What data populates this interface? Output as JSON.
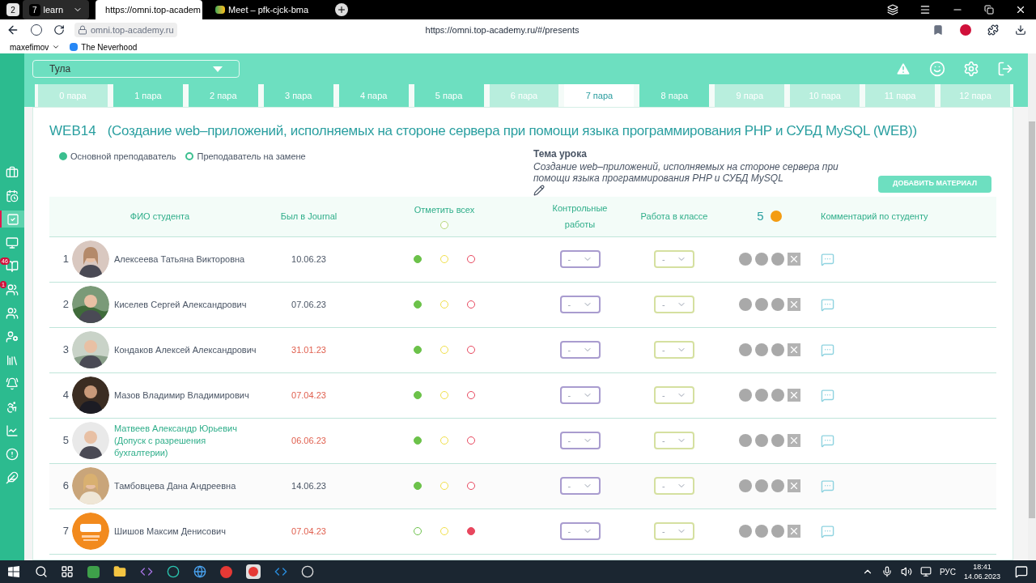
{
  "browser": {
    "workspace": "2",
    "tabs": [
      {
        "label": "7",
        "title": "learn",
        "selected": false
      },
      {
        "title": "https://omni.top-academ",
        "selected": true
      },
      {
        "title": "Meet – pfk-cjck-bma",
        "selected": false
      }
    ],
    "address": {
      "host": "omni.top-academy.ru",
      "url": "https://omni.top-academy.ru/#/presents"
    },
    "bookmarks": [
      "maxefimov",
      "The Neverhood"
    ]
  },
  "sidebar": {
    "items": [
      {
        "selected": false
      },
      {
        "selected": false
      },
      {
        "selected": true
      },
      {
        "selected": false
      },
      {
        "selected": false,
        "badge": "46"
      },
      {
        "selected": false,
        "badge": "1"
      },
      {
        "selected": false
      },
      {
        "selected": false
      },
      {
        "selected": false
      },
      {
        "selected": false
      },
      {
        "selected": false
      },
      {
        "selected": false
      },
      {
        "selected": false
      },
      {
        "selected": false
      }
    ]
  },
  "city_select": {
    "value": "Тула"
  },
  "tabs": [
    {
      "label": "0 пара",
      "selected": false,
      "disabled": true
    },
    {
      "label": "1 пара",
      "selected": false,
      "disabled": false
    },
    {
      "label": "2 пара",
      "selected": false,
      "disabled": false
    },
    {
      "label": "3 пара",
      "selected": false,
      "disabled": false
    },
    {
      "label": "4 пара",
      "selected": false,
      "disabled": false
    },
    {
      "label": "5 пара",
      "selected": false,
      "disabled": false
    },
    {
      "label": "6 пара",
      "selected": false,
      "disabled": true
    },
    {
      "label": "7 пара",
      "selected": true,
      "disabled": false
    },
    {
      "label": "8 пара",
      "selected": false,
      "disabled": false
    },
    {
      "label": "9 пара",
      "selected": false,
      "disabled": true
    },
    {
      "label": "10 пара",
      "selected": false,
      "disabled": true
    },
    {
      "label": "11 пара",
      "selected": false,
      "disabled": true
    },
    {
      "label": "12 пара",
      "selected": false,
      "disabled": true
    }
  ],
  "lesson": {
    "group": "WEB14",
    "subject": "(Создание web–приложений, исполняемых на стороне сервера при помощи языка программирования PHP и СУБД MySQL (WEB))",
    "legend": [
      {
        "label": "Основной преподаватель",
        "selected": true
      },
      {
        "label": "Преподаватель на замене",
        "selected": false
      }
    ],
    "topic_label": "Тема урока",
    "topic": "Создание web–приложений, исполняемых на стороне сервера при помощи языка программирования PHP и СУБД MySQL",
    "add_button": "ДОБАВИТЬ МАТЕРИАЛ"
  },
  "table": {
    "columns": [
      "ФИО студента",
      "Был в Journal",
      "Отметить всех",
      "Контрольные работы",
      "Работа в классе",
      "5",
      "Комментарий по студенту"
    ],
    "mark_all": {
      "checked": false
    },
    "rows": [
      {
        "number": "1",
        "name": "Алексеева Татьяна Викторовна",
        "highlighted": false,
        "journal": "10.06.23",
        "overdue": false,
        "attendance": [
          {
            "selected": true
          },
          {
            "selected": false
          },
          {
            "selected": false
          }
        ],
        "control_work": "-",
        "class_work": "-"
      },
      {
        "number": "2",
        "name": "Киселев Сергей Александрович",
        "highlighted": false,
        "journal": "07.06.23",
        "overdue": false,
        "attendance": [
          {
            "selected": true
          },
          {
            "selected": false
          },
          {
            "selected": false
          }
        ],
        "control_work": "-",
        "class_work": "-"
      },
      {
        "number": "3",
        "name": "Кондаков Алексей Александрович",
        "highlighted": false,
        "journal": "31.01.23",
        "overdue": true,
        "attendance": [
          {
            "selected": true
          },
          {
            "selected": false
          },
          {
            "selected": false
          }
        ],
        "control_work": "-",
        "class_work": "-"
      },
      {
        "number": "4",
        "name": "Мазов Владимир Владимирович",
        "highlighted": false,
        "journal": "07.04.23",
        "overdue": true,
        "attendance": [
          {
            "selected": true
          },
          {
            "selected": false
          },
          {
            "selected": false
          }
        ],
        "control_work": "-",
        "class_work": "-"
      },
      {
        "number": "5",
        "name": "Матвеев Александр Юрьевич (Допуск с разрешения бухгалтерии)",
        "highlighted": true,
        "journal": "06.06.23",
        "overdue": true,
        "attendance": [
          {
            "selected": true
          },
          {
            "selected": false
          },
          {
            "selected": false
          }
        ],
        "control_work": "-",
        "class_work": "-"
      },
      {
        "number": "6",
        "name": "Тамбовцева Дана Андреевна",
        "highlighted": false,
        "journal": "14.06.23",
        "overdue": false,
        "attendance": [
          {
            "selected": true
          },
          {
            "selected": false
          },
          {
            "selected": false
          }
        ],
        "control_work": "-",
        "class_work": "-"
      },
      {
        "number": "7",
        "name": "Шишов Максим Денисович",
        "highlighted": false,
        "journal": "07.04.23",
        "overdue": true,
        "attendance": [
          {
            "selected": false
          },
          {
            "selected": false
          },
          {
            "selected": true
          }
        ],
        "control_work": "-",
        "class_work": "-"
      }
    ]
  },
  "taskbar": {
    "language": "РУС",
    "time": "18:41",
    "date": "14.06.2023"
  }
}
